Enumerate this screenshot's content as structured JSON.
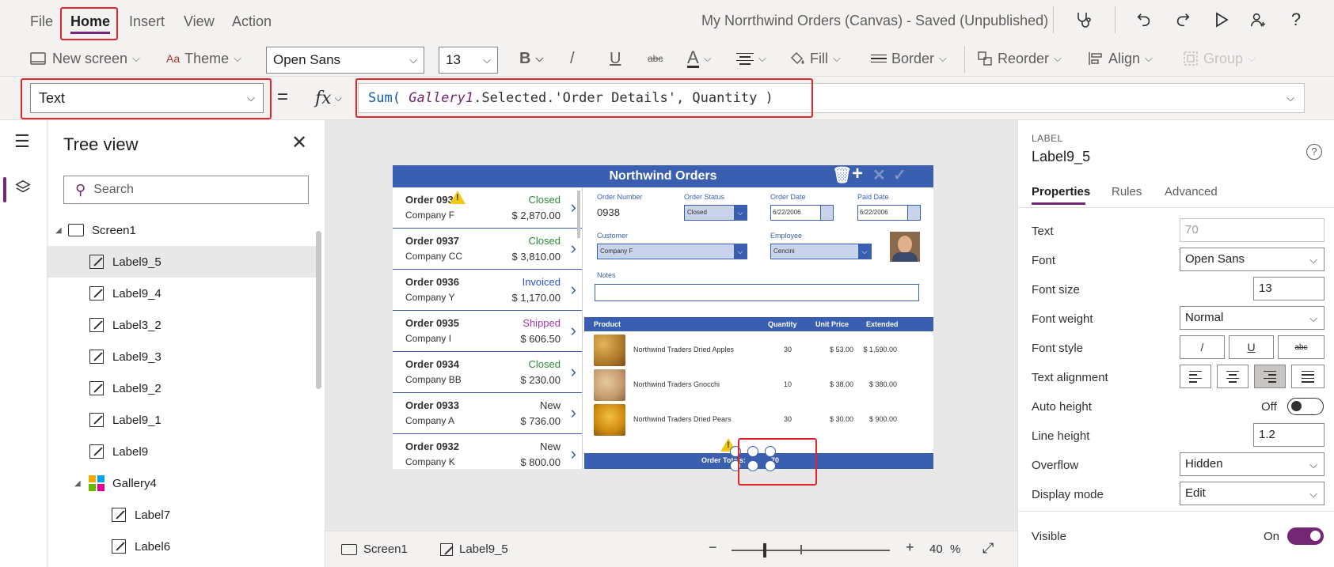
{
  "menu": {
    "file": "File",
    "home": "Home",
    "insert": "Insert",
    "view": "View",
    "action": "Action",
    "app_title": "My Norrthwind Orders (Canvas) - Saved (Unpublished)"
  },
  "ribbon": {
    "new_screen": "New screen",
    "theme": "Theme",
    "font": "Open Sans",
    "font_size": "13",
    "bold": "B",
    "italic": "/",
    "underline": "U",
    "strike": "abc",
    "font_color": "A",
    "fill": "Fill",
    "border": "Border",
    "reorder": "Reorder",
    "align": "Align",
    "group": "Group"
  },
  "formula_bar": {
    "property": "Text",
    "equals": "=",
    "fx": "fx",
    "formula_fn": "Sum(",
    "formula_ctl": "Gallery1",
    "formula_rest": ".Selected.'Order Details', Quantity )"
  },
  "tree": {
    "title": "Tree view",
    "search_placeholder": "Search",
    "nodes": [
      {
        "label": "Screen1"
      },
      {
        "label": "Label9_5"
      },
      {
        "label": "Label9_4"
      },
      {
        "label": "Label3_2"
      },
      {
        "label": "Label9_3"
      },
      {
        "label": "Label9_2"
      },
      {
        "label": "Label9_1"
      },
      {
        "label": "Label9"
      },
      {
        "label": "Gallery4"
      },
      {
        "label": "Label7"
      },
      {
        "label": "Label6"
      }
    ]
  },
  "app": {
    "title": "Northwind Orders",
    "orders": [
      {
        "number": "Order 0938",
        "company": "Company F",
        "status": "Closed",
        "amount": "$ 2,870.00",
        "status_color": "#2e8b3a"
      },
      {
        "number": "Order 0937",
        "company": "Company CC",
        "status": "Closed",
        "amount": "$ 3,810.00",
        "status_color": "#2e8b3a"
      },
      {
        "number": "Order 0936",
        "company": "Company Y",
        "status": "Invoiced",
        "amount": "$ 1,170.00",
        "status_color": "#2b50d6"
      },
      {
        "number": "Order 0935",
        "company": "Company I",
        "status": "Shipped",
        "amount": "$ 606.50",
        "status_color": "#a23aa8"
      },
      {
        "number": "Order 0934",
        "company": "Company BB",
        "status": "Closed",
        "amount": "$ 230.00",
        "status_color": "#2e8b3a"
      },
      {
        "number": "Order 0933",
        "company": "Company A",
        "status": "New",
        "amount": "$ 736.00",
        "status_color": "#323130"
      },
      {
        "number": "Order 0932",
        "company": "Company K",
        "status": "New",
        "amount": "$ 800.00",
        "status_color": "#323130"
      }
    ],
    "form": {
      "order_number_label": "Order Number",
      "order_number": "0938",
      "order_status_label": "Order Status",
      "order_status": "Closed",
      "order_date_label": "Order Date",
      "order_date": "6/22/2006",
      "paid_date_label": "Paid Date",
      "paid_date": "6/22/2006",
      "customer_label": "Customer",
      "customer": "Company F",
      "employee_label": "Employee",
      "employee": "Cencini",
      "notes_label": "Notes"
    },
    "details": {
      "headers": {
        "product": "Product",
        "quantity": "Quantity",
        "unit_price": "Unit Price",
        "extended": "Extended"
      },
      "rows": [
        {
          "product": "Northwind Traders Dried Apples",
          "quantity": "30",
          "unit_price": "$ 53.00",
          "extended": "$ 1,590.00"
        },
        {
          "product": "Northwind Traders Gnocchi",
          "quantity": "10",
          "unit_price": "$ 38.00",
          "extended": "$ 380.00"
        },
        {
          "product": "Northwind Traders Dried Pears",
          "quantity": "30",
          "unit_price": "$ 30.00",
          "extended": "$ 900.00"
        }
      ],
      "totals_label": "Order Totals:",
      "totals_value": "70"
    }
  },
  "statusbar": {
    "screen": "Screen1",
    "control": "Label9_5",
    "zoom": "40",
    "zoom_unit": "%"
  },
  "props": {
    "kind": "LABEL",
    "name": "Label9_5",
    "tabs": [
      "Properties",
      "Rules",
      "Advanced"
    ],
    "text_label": "Text",
    "text_value": "70",
    "font_label": "Font",
    "font_value": "Open Sans",
    "font_size_label": "Font size",
    "font_size_value": "13",
    "font_weight_label": "Font weight",
    "font_weight_value": "Normal",
    "font_style_label": "Font style",
    "font_style_italic": "/",
    "font_style_underline": "U",
    "font_style_strike": "abc",
    "text_align_label": "Text alignment",
    "auto_height_label": "Auto height",
    "auto_height_value": "Off",
    "line_height_label": "Line height",
    "line_height_value": "1.2",
    "overflow_label": "Overflow",
    "overflow_value": "Hidden",
    "display_mode_label": "Display mode",
    "display_mode_value": "Edit",
    "visible_label": "Visible",
    "visible_value": "On"
  }
}
